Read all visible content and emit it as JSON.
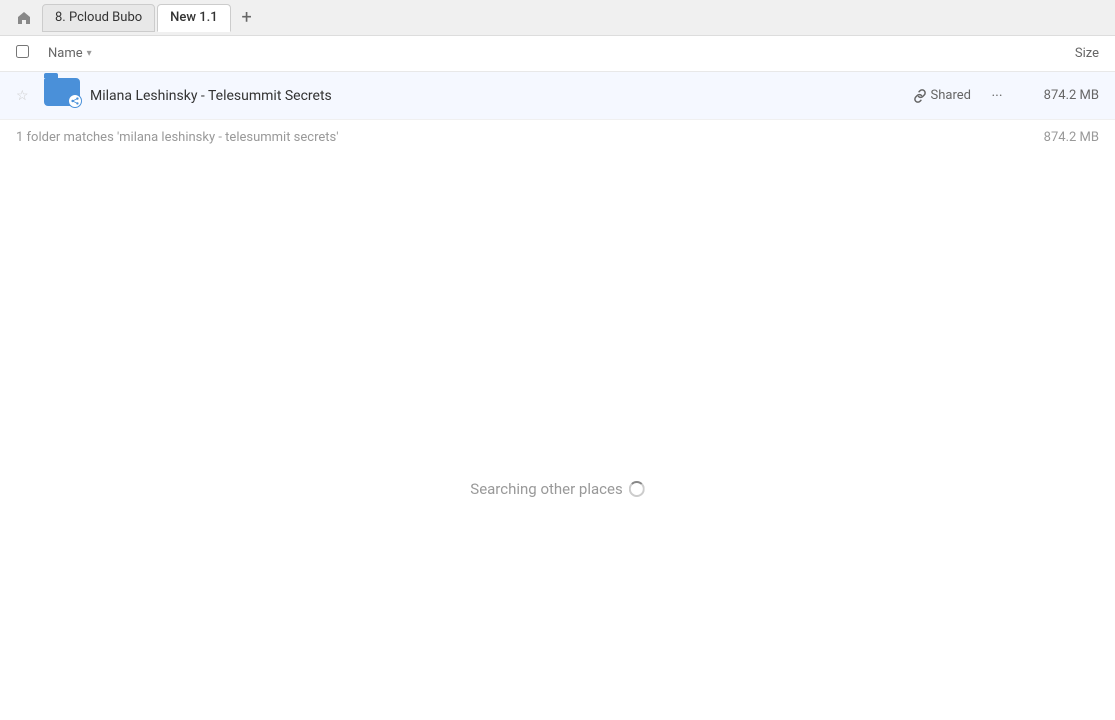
{
  "tabs": {
    "home_title": "Home",
    "tab1_label": "8. Pcloud Bubo",
    "tab2_label": "New 1.1",
    "new_tab_label": "+"
  },
  "columns": {
    "name_label": "Name",
    "size_label": "Size"
  },
  "file_row": {
    "name": "Milana Leshinsky - Telesummit Secrets",
    "shared_label": "Shared",
    "more_dots": "···",
    "size": "874.2 MB",
    "star": "☆"
  },
  "status": {
    "matches_text": "1 folder matches 'milana leshinsky - telesummit secrets'",
    "matches_size": "874.2 MB"
  },
  "search": {
    "searching_text": "Searching other places"
  },
  "icons": {
    "home": "🏠",
    "link": "🔗",
    "chevron_down": "▾"
  }
}
